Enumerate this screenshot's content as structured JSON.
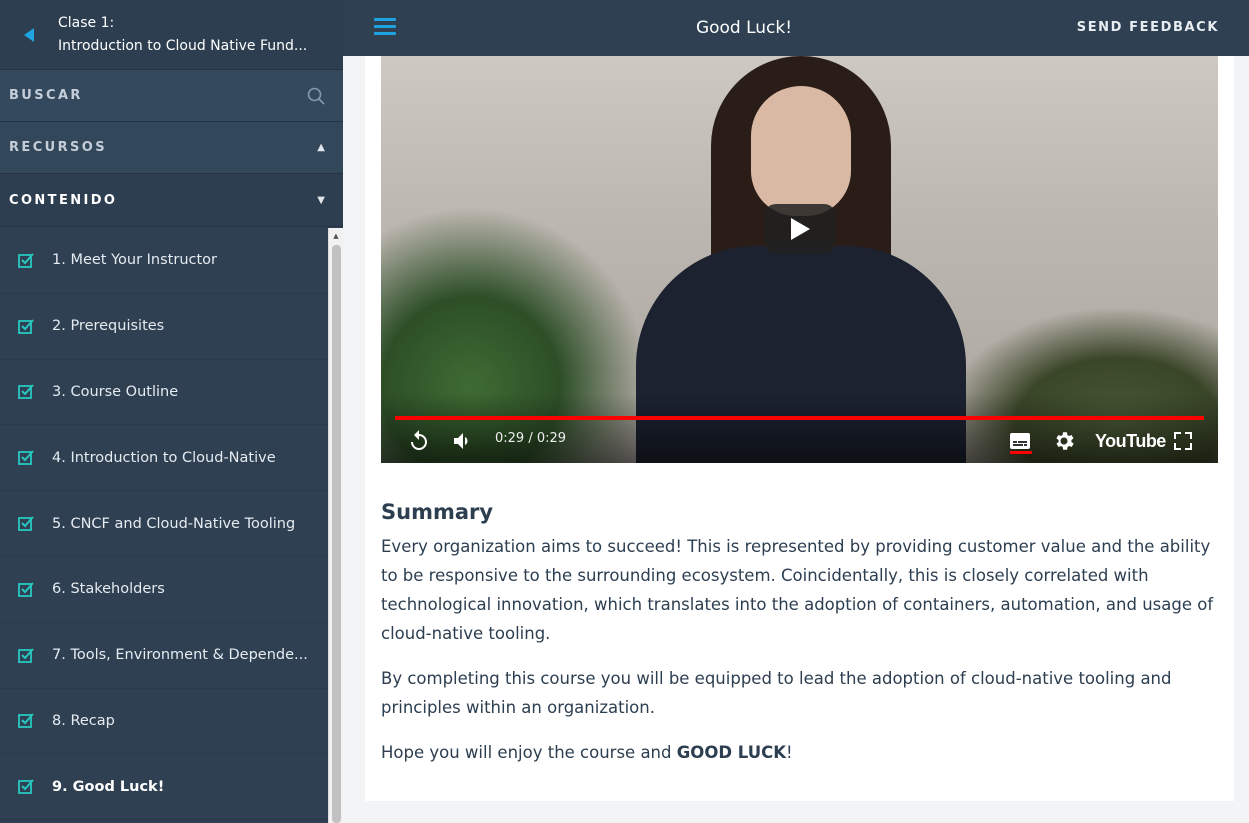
{
  "sidebar": {
    "class_label": "Clase 1:",
    "course_name": "Introduction to Cloud Native Fund...",
    "search_label": "BUSCAR",
    "resources_label": "RECURSOS",
    "content_label": "CONTENIDO",
    "lessons": [
      {
        "label": "1. Meet Your Instructor"
      },
      {
        "label": "2. Prerequisites"
      },
      {
        "label": "3. Course Outline"
      },
      {
        "label": "4. Introduction to Cloud-Native"
      },
      {
        "label": "5. CNCF and Cloud-Native Tooling"
      },
      {
        "label": "6. Stakeholders"
      },
      {
        "label": "7. Tools, Environment & Depende..."
      },
      {
        "label": "8. Recap"
      },
      {
        "label": "9. Good Luck!"
      }
    ]
  },
  "topbar": {
    "title": "Good Luck!",
    "feedback_label": "SEND FEEDBACK"
  },
  "video": {
    "time": "0:29 / 0:29",
    "brand": "YouTube"
  },
  "summary": {
    "heading": "Summary",
    "p1": "Every organization aims to succeed! This is represented by providing customer value and the ability to be responsive to the surrounding ecosystem. Coincidentally, this is closely correlated with technological innovation, which translates into the adoption of containers, automation, and usage of cloud-native tooling.",
    "p2": "By completing this course you will be equipped to lead the adoption of cloud-native tooling and principles within an organization.",
    "p3_prefix": "Hope you will enjoy the course and ",
    "p3_bold": "GOOD LUCK",
    "p3_suffix": "!"
  },
  "colors": {
    "sidebar_bg": "#2e4052",
    "accent": "#1fa3e0",
    "check": "#28c7c0",
    "progress": "#ff0000"
  }
}
